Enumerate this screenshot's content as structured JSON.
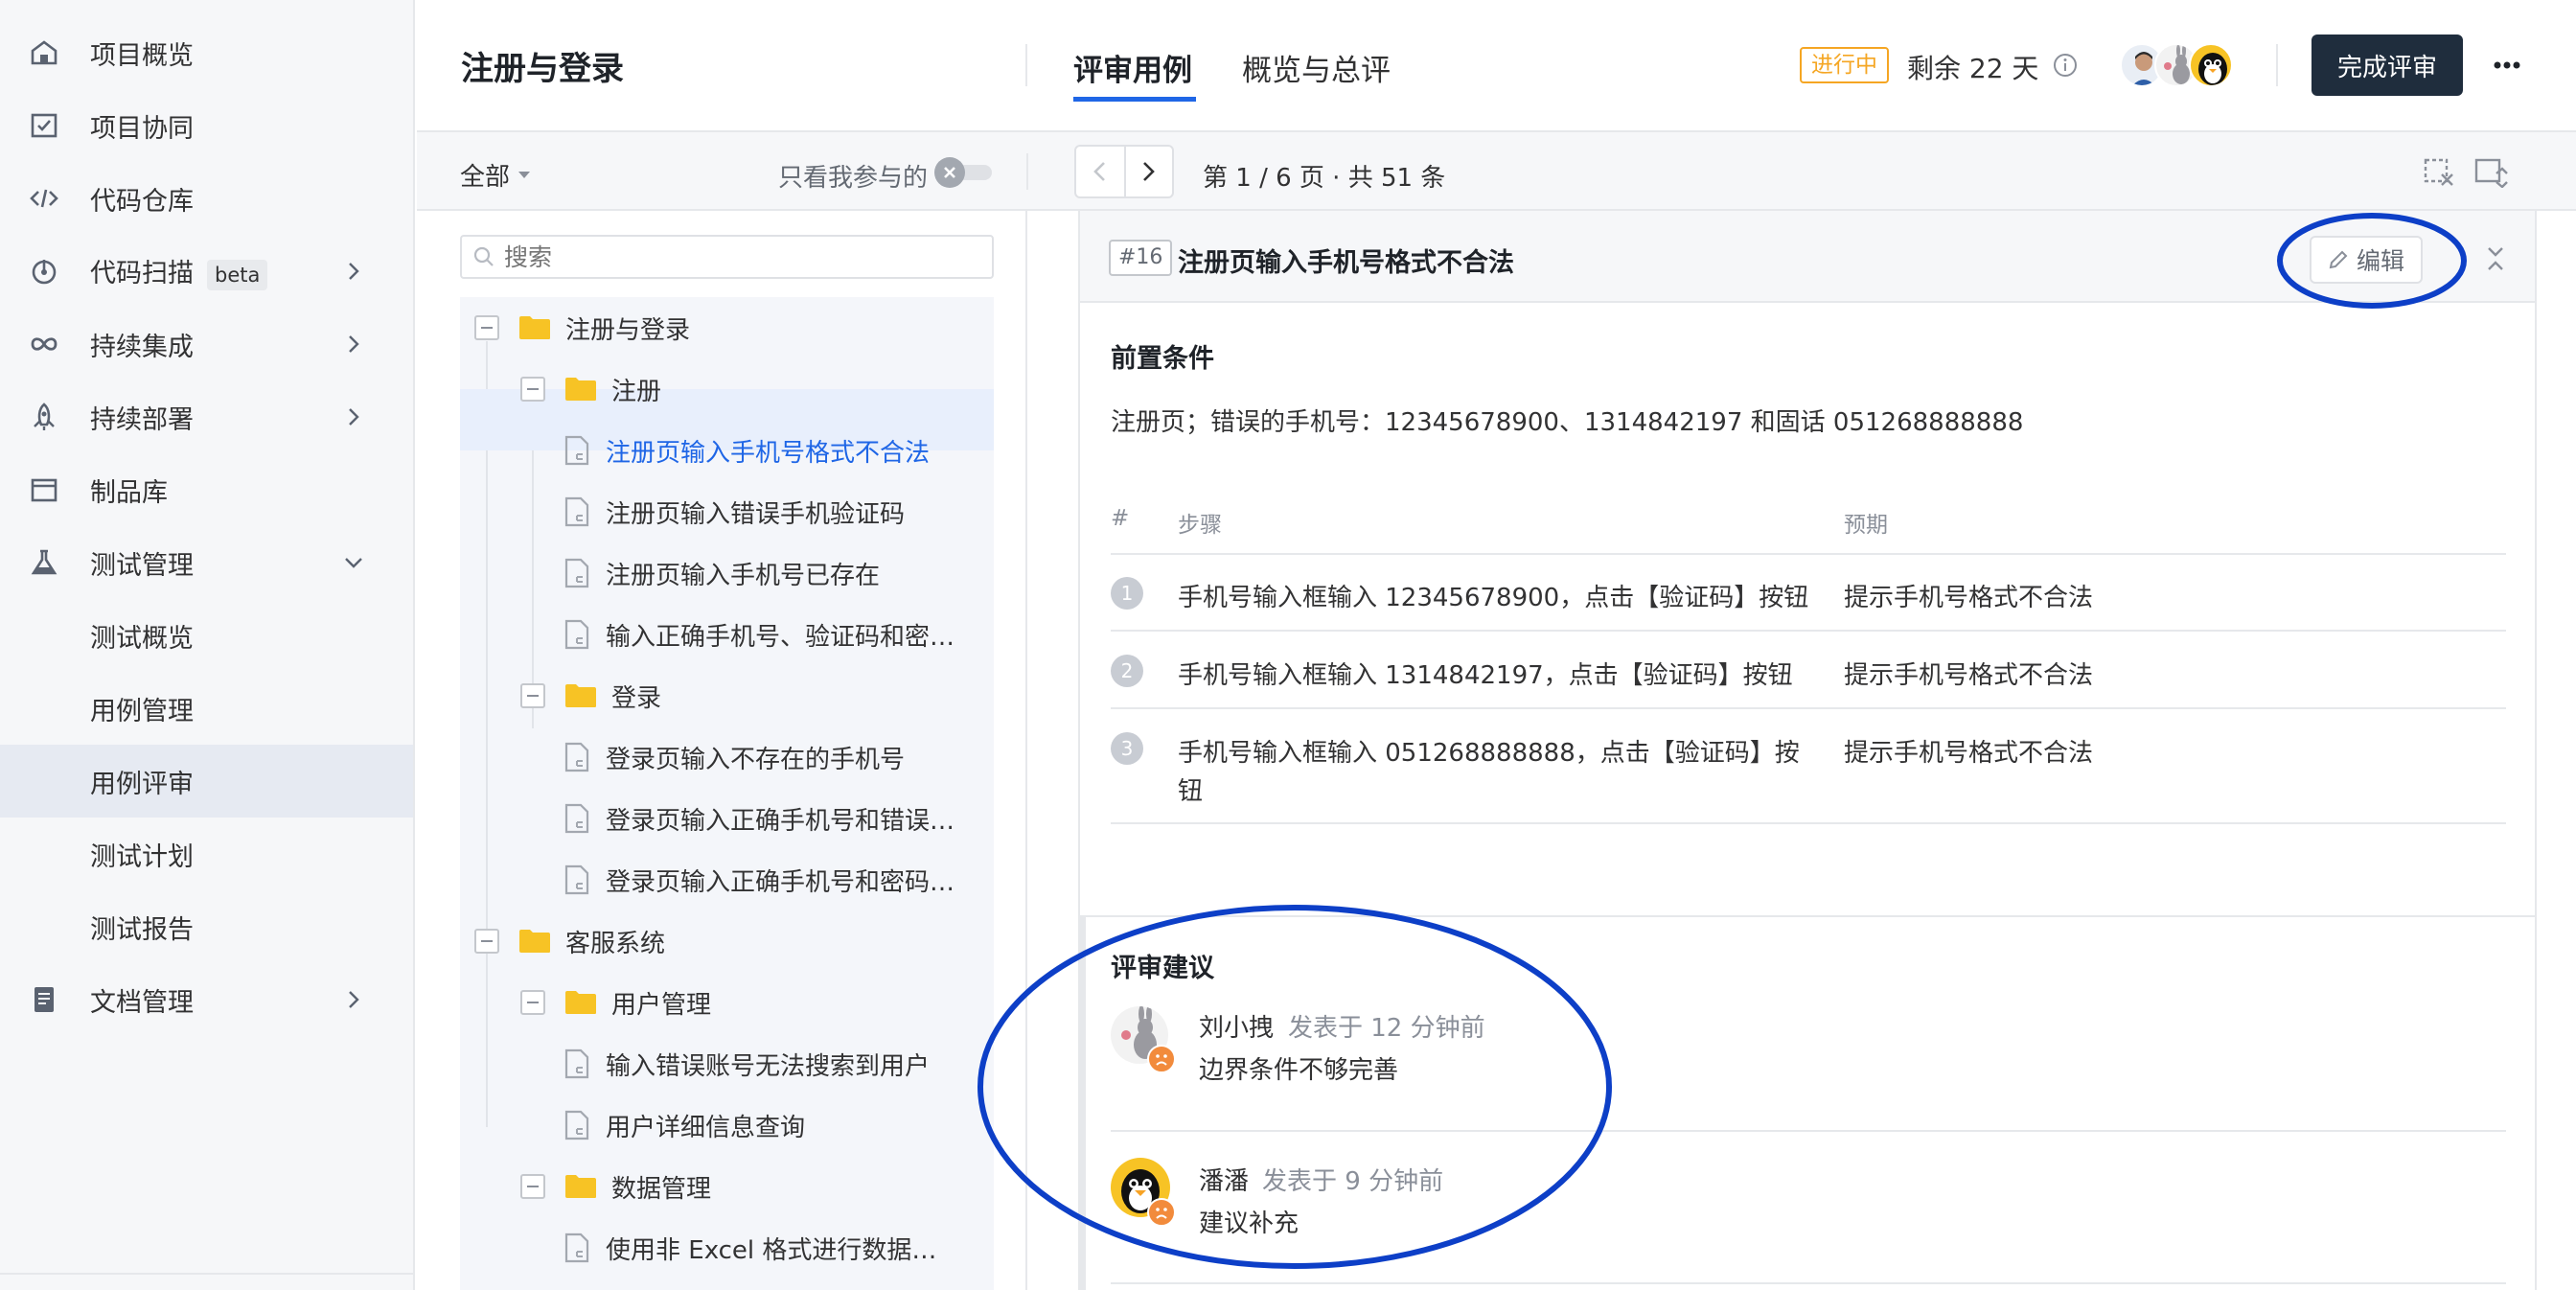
{
  "sidebar": {
    "items": [
      {
        "label": "项目概览",
        "icon": "home-icon"
      },
      {
        "label": "项目协同",
        "icon": "checkbox-icon"
      },
      {
        "label": "代码仓库",
        "icon": "code-icon"
      },
      {
        "label": "代码扫描",
        "icon": "scan-icon",
        "badge": "beta"
      },
      {
        "label": "持续集成",
        "icon": "infinity-icon"
      },
      {
        "label": "持续部署",
        "icon": "rocket-icon"
      },
      {
        "label": "制品库",
        "icon": "box-icon"
      },
      {
        "label": "测试管理",
        "icon": "flask-icon"
      },
      {
        "label": "测试概览"
      },
      {
        "label": "用例管理"
      },
      {
        "label": "用例评审"
      },
      {
        "label": "测试计划"
      },
      {
        "label": "测试报告"
      },
      {
        "label": "文档管理",
        "icon": "document-icon"
      }
    ]
  },
  "header": {
    "title": "注册与登录",
    "tabs": [
      {
        "label": "评审用例"
      },
      {
        "label": "概览与总评"
      }
    ],
    "status_badge": "进行中",
    "remaining": "剩余 22 天",
    "complete_button": "完成评审",
    "more_icon": "more-icon"
  },
  "subbar": {
    "filter": "全部",
    "only_mine": "只看我参与的",
    "pagination": "第 1 / 6 页 · 共 51 条"
  },
  "tree": {
    "search_placeholder": "搜索",
    "nodes": [
      {
        "label": "注册与登录",
        "type": "folder"
      },
      {
        "label": "注册",
        "type": "folder"
      },
      {
        "label": "注册页输入手机号格式不合法",
        "type": "file"
      },
      {
        "label": "注册页输入错误手机验证码",
        "type": "file"
      },
      {
        "label": "注册页输入手机号已存在",
        "type": "file"
      },
      {
        "label": "输入正确手机号、验证码和密…",
        "type": "file"
      },
      {
        "label": "登录",
        "type": "folder"
      },
      {
        "label": "登录页输入不存在的手机号",
        "type": "file"
      },
      {
        "label": "登录页输入正确手机号和错误…",
        "type": "file"
      },
      {
        "label": "登录页输入正确手机号和密码…",
        "type": "file"
      },
      {
        "label": "客服系统",
        "type": "folder"
      },
      {
        "label": "用户管理",
        "type": "folder"
      },
      {
        "label": "输入错误账号无法搜索到用户",
        "type": "file"
      },
      {
        "label": "用户详细信息查询",
        "type": "file"
      },
      {
        "label": "数据管理",
        "type": "folder"
      },
      {
        "label": "使用非 Excel 格式进行数据…",
        "type": "file"
      }
    ]
  },
  "detail": {
    "case_id": "#16",
    "case_title": "注册页输入手机号格式不合法",
    "edit_button": "编辑",
    "precondition_heading": "前置条件",
    "precondition_text": "注册页；错误的手机号：12345678900、1314842197 和固话 051268888888",
    "table_headers": {
      "num": "#",
      "step": "步骤",
      "expected": "预期"
    },
    "steps": [
      {
        "num": "1",
        "step": "手机号输入框输入 12345678900，点击【验证码】按钮",
        "expected": "提示手机号格式不合法"
      },
      {
        "num": "2",
        "step": "手机号输入框输入 1314842197，点击【验证码】按钮",
        "expected": "提示手机号格式不合法"
      },
      {
        "num": "3",
        "step_line1": "手机号输入框输入 051268888888，点击【验证码】按",
        "step_line2": "钮",
        "expected": "提示手机号格式不合法"
      }
    ],
    "review_heading": "评审建议",
    "comments": [
      {
        "author": "刘小拽",
        "time": "发表于 12 分钟前",
        "text": "边界条件不够完善"
      },
      {
        "author": "潘潘",
        "time": "发表于 9 分钟前",
        "text": "建议补充"
      }
    ]
  },
  "colors": {
    "accent": "#1f66e6",
    "annotation": "#0d3fc7",
    "status": "#f5a623",
    "dark_button": "#1f2d3d"
  }
}
